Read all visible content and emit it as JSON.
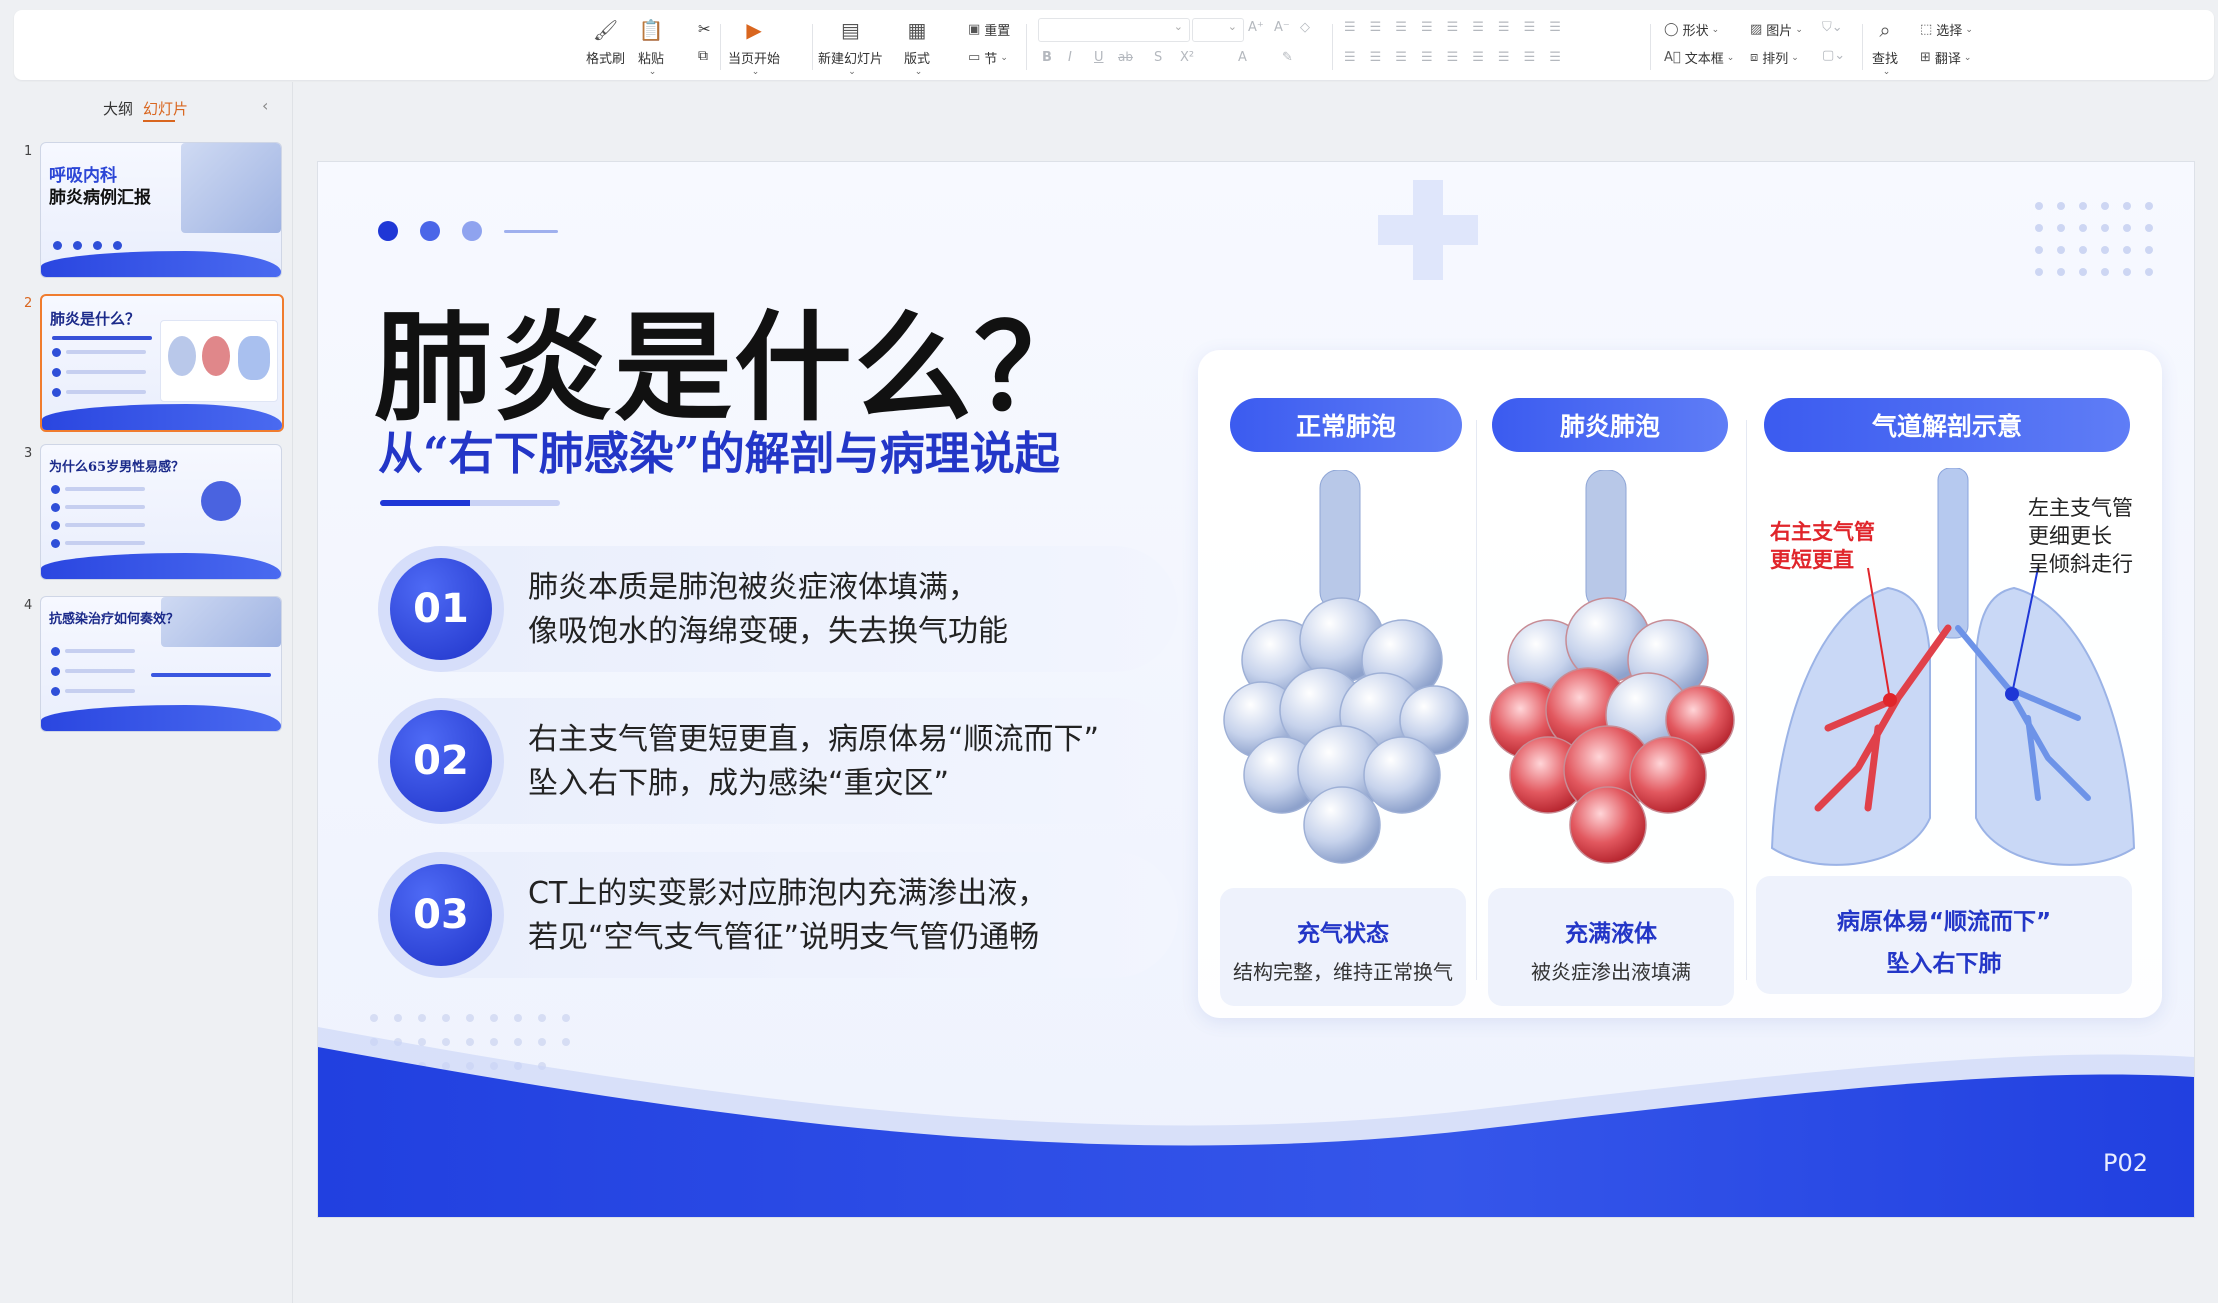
{
  "ribbon": {
    "format_painter": "格式刷",
    "paste": "粘贴",
    "play_from_current": "当页开始",
    "new_slide": "新建幻灯片",
    "layout": "版式",
    "reset": "重置",
    "section": "节",
    "shape": "形状",
    "picture": "图片",
    "textbox": "文本框",
    "arrange": "排列",
    "find": "查找",
    "select": "选择",
    "translate": "翻译"
  },
  "left_panel": {
    "tab_outline": "大纲",
    "tab_slides": "幻灯片",
    "thumbnails": [
      {
        "num": "1",
        "title_l1": "呼吸内科",
        "title_l2": "肺炎病例汇报"
      },
      {
        "num": "2",
        "title_l1": "肺炎是什么？",
        "title_l2": ""
      },
      {
        "num": "3",
        "title_l1": "为什么65岁男性易感？",
        "title_l2": ""
      },
      {
        "num": "4",
        "title_l1": "抗感染治疗如何奏效？",
        "title_l2": ""
      }
    ]
  },
  "slide": {
    "title": "肺炎是什么？",
    "subtitle": "从“右下肺感染”的解剖与病理说起",
    "points": [
      {
        "num": "01",
        "line1": "肺炎本质是肺泡被炎症液体填满，",
        "line2": "像吸饱水的海绵变硬，失去换气功能"
      },
      {
        "num": "02",
        "line1": "右主支气管更短更直，病原体易“顺流而下”",
        "line2": "坠入右下肺，成为感染“重灾区”"
      },
      {
        "num": "03",
        "line1": "CT上的实变影对应肺泡内充满渗出液，",
        "line2": "若见“空气支气管征”说明支气管仍通畅"
      }
    ],
    "panels": [
      {
        "header": "正常肺泡",
        "cap_title": "充气状态",
        "cap_text": "结构完整，维持正常换气"
      },
      {
        "header": "肺炎肺泡",
        "cap_title": "充满液体",
        "cap_text": "被炎症渗出液填满"
      },
      {
        "header": "气道解剖示意",
        "cap_title": "病原体易“顺流而下”",
        "cap_text": "坠入右下肺"
      }
    ],
    "annotation_right_l1": "右主支气管",
    "annotation_right_l2": "更短更直",
    "annotation_left_l1": "左主支气管",
    "annotation_left_l2": "更细更长",
    "annotation_left_l3": "呈倾斜走行",
    "page_number": "P02"
  },
  "colors": {
    "accent_blue": "#2336c7",
    "header_blue": "#3b5bf0",
    "alert_red": "#e0252b",
    "selection_orange": "#f07c2e"
  }
}
